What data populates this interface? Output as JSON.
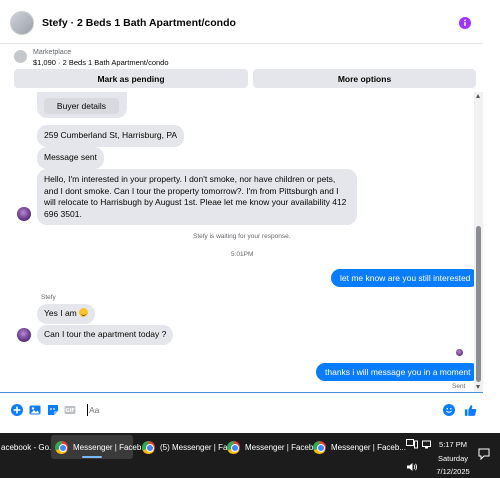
{
  "header": {
    "title": "Stefy · 2 Beds 1 Bath Apartment/condo",
    "info_icon": "info-icon"
  },
  "marketplace": {
    "label": "Marketplace",
    "item": "$1,090 · 2 Beds 1 Bath Apartment/condo",
    "pending_label": "Mark as pending",
    "more_label": "More options"
  },
  "chat": {
    "buyer_details_label": "Buyer details",
    "address_text": "259 Cumberland St, Harrisburg, PA",
    "message_sent_text": "Message sent",
    "long_message": "Hello, I'm interested in your property. I don't smoke, nor have children or pets, and I dont smoke. Can I tour the property tomorrow?. I'm from Pittsburgh and I will relocate to Harrisbugh by August 1st. Pleae let me know your availability 412 696 3501.",
    "waiting_text": "Stefy is waiting for your response.",
    "time_text": "5:01PM",
    "out_message_1": "let me know are you still interested",
    "sender_name": "Stefy",
    "in_message_1": "Yes I am",
    "in_message_2": "Can I tour the apartment today ?",
    "out_message_2": "thanks i will message you in a moment",
    "sent_status": "Sent"
  },
  "composer": {
    "placeholder": "Aa",
    "icons": [
      "plus-circle-icon",
      "photo-icon",
      "sticker-icon",
      "gif-icon",
      "emoji-icon",
      "thumbs-up-icon"
    ]
  },
  "taskbar": {
    "items": [
      {
        "label": "acebook - Go..."
      },
      {
        "label": "Messenger | Faceb..."
      },
      {
        "label": "(5) Messenger | Fa..."
      },
      {
        "label": "Messenger | Faceb..."
      },
      {
        "label": "Messenger | Faceb..."
      }
    ],
    "time": "5:17 PM",
    "day": "Saturday",
    "date": "7/12/2025"
  },
  "colors": {
    "accent": "#0a7cff",
    "bubble_in": "#e4e6eb",
    "info": "#a033ff",
    "taskbar": "#1c1c1c"
  }
}
